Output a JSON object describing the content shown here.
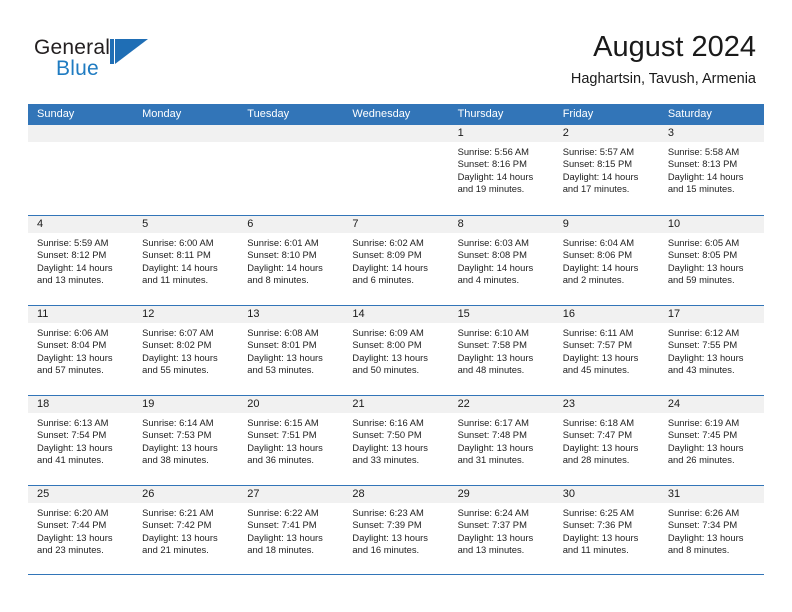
{
  "brand": {
    "name_part1": "General",
    "name_part2": "Blue",
    "logo_icon": "flag-triangle-icon",
    "accent_color": "#1f7bc1"
  },
  "header": {
    "title": "August 2024",
    "subtitle": "Haghartsin, Tavush, Armenia"
  },
  "calendar": {
    "header_bg": "#3275b8",
    "day_band_bg": "#f1f1f1",
    "weekdays": [
      "Sunday",
      "Monday",
      "Tuesday",
      "Wednesday",
      "Thursday",
      "Friday",
      "Saturday"
    ],
    "weeks": [
      [
        {
          "day": "",
          "empty": true
        },
        {
          "day": "",
          "empty": true
        },
        {
          "day": "",
          "empty": true
        },
        {
          "day": "",
          "empty": true
        },
        {
          "day": "1",
          "sunrise": "Sunrise: 5:56 AM",
          "sunset": "Sunset: 8:16 PM",
          "daylight_line1": "Daylight: 14 hours",
          "daylight_line2": "and 19 minutes."
        },
        {
          "day": "2",
          "sunrise": "Sunrise: 5:57 AM",
          "sunset": "Sunset: 8:15 PM",
          "daylight_line1": "Daylight: 14 hours",
          "daylight_line2": "and 17 minutes."
        },
        {
          "day": "3",
          "sunrise": "Sunrise: 5:58 AM",
          "sunset": "Sunset: 8:13 PM",
          "daylight_line1": "Daylight: 14 hours",
          "daylight_line2": "and 15 minutes."
        }
      ],
      [
        {
          "day": "4",
          "sunrise": "Sunrise: 5:59 AM",
          "sunset": "Sunset: 8:12 PM",
          "daylight_line1": "Daylight: 14 hours",
          "daylight_line2": "and 13 minutes."
        },
        {
          "day": "5",
          "sunrise": "Sunrise: 6:00 AM",
          "sunset": "Sunset: 8:11 PM",
          "daylight_line1": "Daylight: 14 hours",
          "daylight_line2": "and 11 minutes."
        },
        {
          "day": "6",
          "sunrise": "Sunrise: 6:01 AM",
          "sunset": "Sunset: 8:10 PM",
          "daylight_line1": "Daylight: 14 hours",
          "daylight_line2": "and 8 minutes."
        },
        {
          "day": "7",
          "sunrise": "Sunrise: 6:02 AM",
          "sunset": "Sunset: 8:09 PM",
          "daylight_line1": "Daylight: 14 hours",
          "daylight_line2": "and 6 minutes."
        },
        {
          "day": "8",
          "sunrise": "Sunrise: 6:03 AM",
          "sunset": "Sunset: 8:08 PM",
          "daylight_line1": "Daylight: 14 hours",
          "daylight_line2": "and 4 minutes."
        },
        {
          "day": "9",
          "sunrise": "Sunrise: 6:04 AM",
          "sunset": "Sunset: 8:06 PM",
          "daylight_line1": "Daylight: 14 hours",
          "daylight_line2": "and 2 minutes."
        },
        {
          "day": "10",
          "sunrise": "Sunrise: 6:05 AM",
          "sunset": "Sunset: 8:05 PM",
          "daylight_line1": "Daylight: 13 hours",
          "daylight_line2": "and 59 minutes."
        }
      ],
      [
        {
          "day": "11",
          "sunrise": "Sunrise: 6:06 AM",
          "sunset": "Sunset: 8:04 PM",
          "daylight_line1": "Daylight: 13 hours",
          "daylight_line2": "and 57 minutes."
        },
        {
          "day": "12",
          "sunrise": "Sunrise: 6:07 AM",
          "sunset": "Sunset: 8:02 PM",
          "daylight_line1": "Daylight: 13 hours",
          "daylight_line2": "and 55 minutes."
        },
        {
          "day": "13",
          "sunrise": "Sunrise: 6:08 AM",
          "sunset": "Sunset: 8:01 PM",
          "daylight_line1": "Daylight: 13 hours",
          "daylight_line2": "and 53 minutes."
        },
        {
          "day": "14",
          "sunrise": "Sunrise: 6:09 AM",
          "sunset": "Sunset: 8:00 PM",
          "daylight_line1": "Daylight: 13 hours",
          "daylight_line2": "and 50 minutes."
        },
        {
          "day": "15",
          "sunrise": "Sunrise: 6:10 AM",
          "sunset": "Sunset: 7:58 PM",
          "daylight_line1": "Daylight: 13 hours",
          "daylight_line2": "and 48 minutes."
        },
        {
          "day": "16",
          "sunrise": "Sunrise: 6:11 AM",
          "sunset": "Sunset: 7:57 PM",
          "daylight_line1": "Daylight: 13 hours",
          "daylight_line2": "and 45 minutes."
        },
        {
          "day": "17",
          "sunrise": "Sunrise: 6:12 AM",
          "sunset": "Sunset: 7:55 PM",
          "daylight_line1": "Daylight: 13 hours",
          "daylight_line2": "and 43 minutes."
        }
      ],
      [
        {
          "day": "18",
          "sunrise": "Sunrise: 6:13 AM",
          "sunset": "Sunset: 7:54 PM",
          "daylight_line1": "Daylight: 13 hours",
          "daylight_line2": "and 41 minutes."
        },
        {
          "day": "19",
          "sunrise": "Sunrise: 6:14 AM",
          "sunset": "Sunset: 7:53 PM",
          "daylight_line1": "Daylight: 13 hours",
          "daylight_line2": "and 38 minutes."
        },
        {
          "day": "20",
          "sunrise": "Sunrise: 6:15 AM",
          "sunset": "Sunset: 7:51 PM",
          "daylight_line1": "Daylight: 13 hours",
          "daylight_line2": "and 36 minutes."
        },
        {
          "day": "21",
          "sunrise": "Sunrise: 6:16 AM",
          "sunset": "Sunset: 7:50 PM",
          "daylight_line1": "Daylight: 13 hours",
          "daylight_line2": "and 33 minutes."
        },
        {
          "day": "22",
          "sunrise": "Sunrise: 6:17 AM",
          "sunset": "Sunset: 7:48 PM",
          "daylight_line1": "Daylight: 13 hours",
          "daylight_line2": "and 31 minutes."
        },
        {
          "day": "23",
          "sunrise": "Sunrise: 6:18 AM",
          "sunset": "Sunset: 7:47 PM",
          "daylight_line1": "Daylight: 13 hours",
          "daylight_line2": "and 28 minutes."
        },
        {
          "day": "24",
          "sunrise": "Sunrise: 6:19 AM",
          "sunset": "Sunset: 7:45 PM",
          "daylight_line1": "Daylight: 13 hours",
          "daylight_line2": "and 26 minutes."
        }
      ],
      [
        {
          "day": "25",
          "sunrise": "Sunrise: 6:20 AM",
          "sunset": "Sunset: 7:44 PM",
          "daylight_line1": "Daylight: 13 hours",
          "daylight_line2": "and 23 minutes."
        },
        {
          "day": "26",
          "sunrise": "Sunrise: 6:21 AM",
          "sunset": "Sunset: 7:42 PM",
          "daylight_line1": "Daylight: 13 hours",
          "daylight_line2": "and 21 minutes."
        },
        {
          "day": "27",
          "sunrise": "Sunrise: 6:22 AM",
          "sunset": "Sunset: 7:41 PM",
          "daylight_line1": "Daylight: 13 hours",
          "daylight_line2": "and 18 minutes."
        },
        {
          "day": "28",
          "sunrise": "Sunrise: 6:23 AM",
          "sunset": "Sunset: 7:39 PM",
          "daylight_line1": "Daylight: 13 hours",
          "daylight_line2": "and 16 minutes."
        },
        {
          "day": "29",
          "sunrise": "Sunrise: 6:24 AM",
          "sunset": "Sunset: 7:37 PM",
          "daylight_line1": "Daylight: 13 hours",
          "daylight_line2": "and 13 minutes."
        },
        {
          "day": "30",
          "sunrise": "Sunrise: 6:25 AM",
          "sunset": "Sunset: 7:36 PM",
          "daylight_line1": "Daylight: 13 hours",
          "daylight_line2": "and 11 minutes."
        },
        {
          "day": "31",
          "sunrise": "Sunrise: 6:26 AM",
          "sunset": "Sunset: 7:34 PM",
          "daylight_line1": "Daylight: 13 hours",
          "daylight_line2": "and 8 minutes."
        }
      ]
    ]
  }
}
